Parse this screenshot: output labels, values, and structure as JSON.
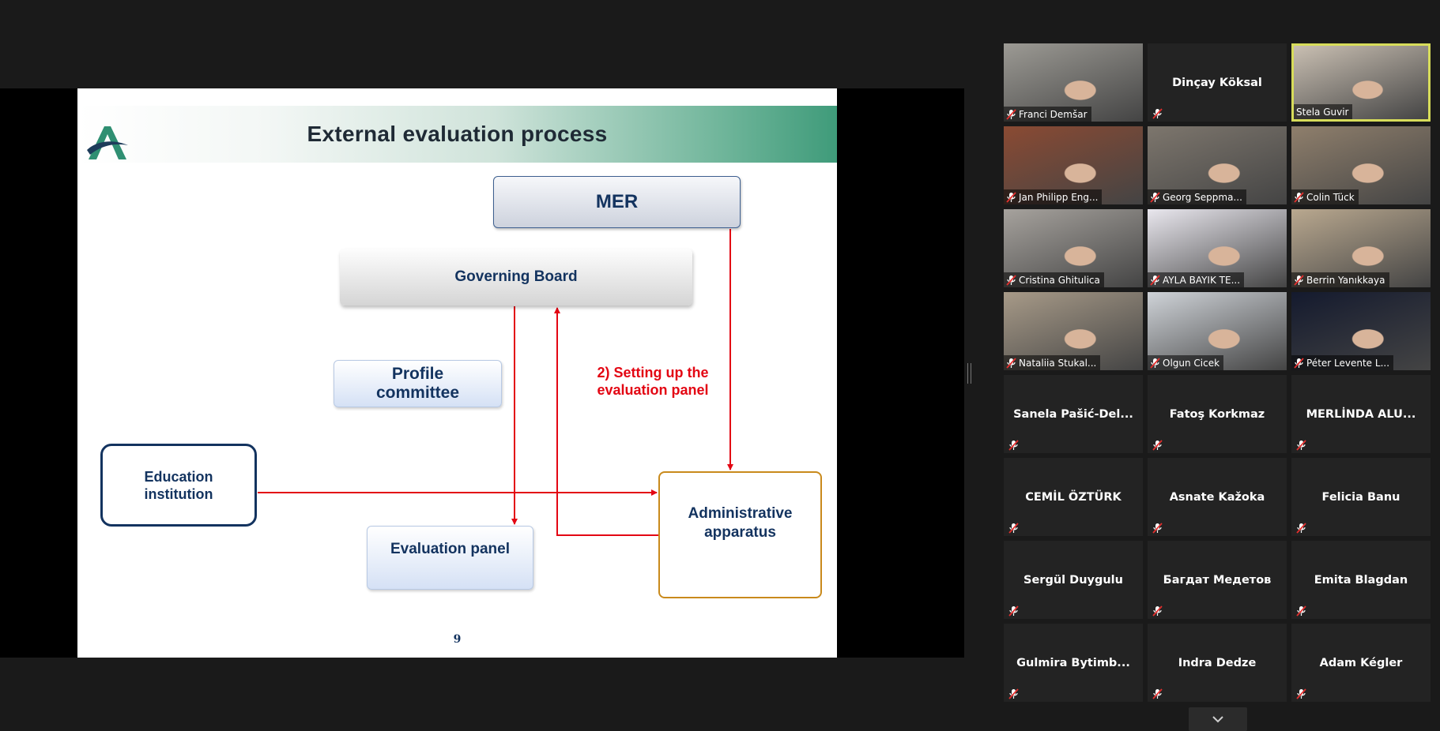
{
  "slide": {
    "title": "External evaluation process",
    "page_number": "9",
    "boxes": {
      "mer": "MER",
      "governing_board": "Governing Board",
      "profile_committee": [
        "Profile",
        "committee"
      ],
      "education_institution": [
        "Education",
        "institution"
      ],
      "evaluation_panel": "Evaluation panel",
      "administrative_apparatus": [
        "Administrative",
        "apparatus"
      ]
    },
    "arrow_label": [
      "2) Setting up the",
      "evaluation panel"
    ],
    "colors": {
      "arrow": "#e30613",
      "box_text": "#13335f",
      "admin_border": "#c98a1c"
    }
  },
  "participants": [
    {
      "name": "Franci Demšar",
      "video": true,
      "muted": true,
      "scene": "#9c9a94"
    },
    {
      "name": "Dinçay Köksal",
      "video": false,
      "muted": true
    },
    {
      "name": "Stela Guvir",
      "video": true,
      "muted": false,
      "active_speaker": true,
      "scene": "#c9bfb2"
    },
    {
      "name": "Jan Philipp Eng...",
      "video": true,
      "muted": true,
      "scene": "#8a4a33"
    },
    {
      "name": "Georg Seppma...",
      "video": true,
      "muted": true,
      "scene": "#7d766d"
    },
    {
      "name": "Colin Tück",
      "video": true,
      "muted": true,
      "scene": "#8f7f6c"
    },
    {
      "name": "Cristina Ghitulica",
      "video": true,
      "muted": true,
      "scene": "#a6a29d"
    },
    {
      "name": "AYLA BAYIK TE...",
      "video": true,
      "muted": true,
      "scene": "#e9e7ee"
    },
    {
      "name": "Berrin Yanıkkaya",
      "video": true,
      "muted": true,
      "scene": "#b9a88f"
    },
    {
      "name": "Nataliia Stukal...",
      "video": true,
      "muted": true,
      "scene": "#a79a88"
    },
    {
      "name": "Olgun Cicek",
      "video": true,
      "muted": true,
      "scene": "#cfd3d8"
    },
    {
      "name": "Péter Levente L...",
      "video": true,
      "muted": true,
      "scene": "#141a2e"
    },
    {
      "name": "Sanela  Pašić-Del...",
      "video": false,
      "muted": true
    },
    {
      "name": "Fatoş Korkmaz",
      "video": false,
      "muted": true
    },
    {
      "name": "MERLİNDA ALU...",
      "video": false,
      "muted": true
    },
    {
      "name": "CEMİL ÖZTÜRK",
      "video": false,
      "muted": true
    },
    {
      "name": "Asnate Kažoka",
      "video": false,
      "muted": true
    },
    {
      "name": "Felicia Banu",
      "video": false,
      "muted": true
    },
    {
      "name": "Sergül Duygulu",
      "video": false,
      "muted": true
    },
    {
      "name": "Багдат Медетов",
      "video": false,
      "muted": true
    },
    {
      "name": "Emita Blagdan",
      "video": false,
      "muted": true
    },
    {
      "name": "Gulmira  Bytimb...",
      "video": false,
      "muted": true
    },
    {
      "name": "Indra Dedze",
      "video": false,
      "muted": true
    },
    {
      "name": "Adam Kégler",
      "video": false,
      "muted": true
    }
  ],
  "icons": {
    "muted": "mic-muted-icon",
    "scroll": "chevron-down-icon",
    "logo": "logo-icon"
  }
}
